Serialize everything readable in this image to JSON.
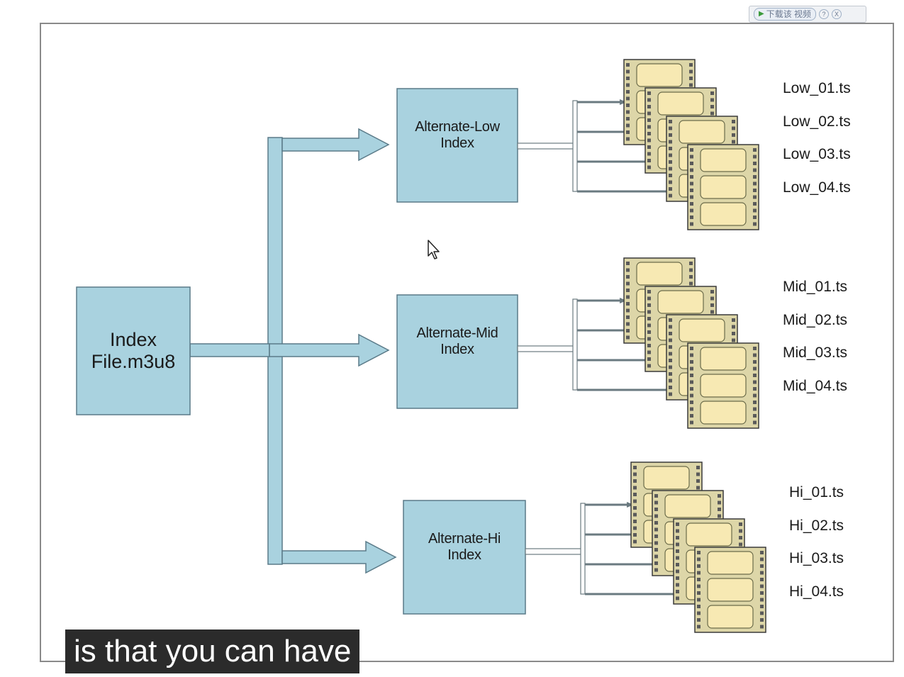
{
  "toolbar": {
    "download_label": "下载该 视频",
    "help_glyph": "?",
    "close_glyph": "X"
  },
  "diagram": {
    "main_box": {
      "line1": "Index",
      "line2": "File.m3u8"
    },
    "alternates": [
      {
        "line1": "Alternate-Low",
        "line2": "Index",
        "files": [
          "Low_01.ts",
          "Low_02.ts",
          "Low_03.ts",
          "Low_04.ts"
        ]
      },
      {
        "line1": "Alternate-Mid",
        "line2": "Index",
        "files": [
          "Mid_01.ts",
          "Mid_02.ts",
          "Mid_03.ts",
          "Mid_04.ts"
        ]
      },
      {
        "line1": "Alternate-Hi",
        "line2": "Index",
        "files": [
          "Hi_01.ts",
          "Hi_02.ts",
          "Hi_03.ts",
          "Hi_04.ts"
        ]
      }
    ]
  },
  "caption": "is that you can have",
  "colors": {
    "box_fill": "#a9d2df",
    "box_stroke": "#5a7a88",
    "film_frame": "#f7e9b3",
    "film_base": "#ddd6a8"
  }
}
